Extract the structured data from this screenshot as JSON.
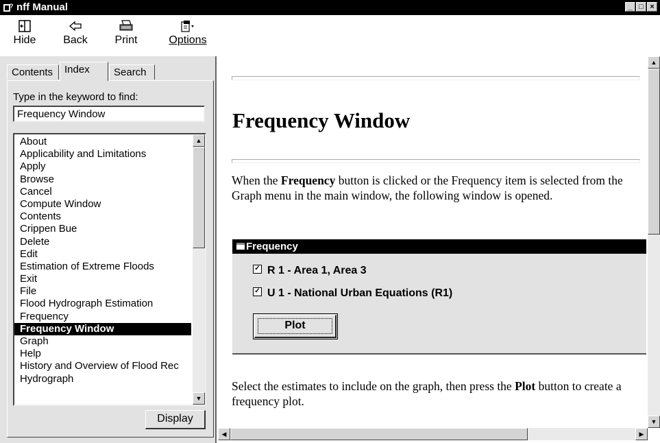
{
  "window": {
    "title": "nff Manual"
  },
  "toolbar": {
    "hide": "Hide",
    "back": "Back",
    "print": "Print",
    "options": "Options"
  },
  "tabs": {
    "contents": "Contents",
    "index": "Index",
    "search": "Search"
  },
  "index": {
    "label": "Type in the keyword to find:",
    "value": "Frequency Window",
    "items": [
      "About",
      "Applicability and Limitations",
      "Apply",
      "Browse",
      "Cancel",
      "Compute Window",
      "Contents",
      "Crippen Bue",
      "Delete",
      "Edit",
      "Estimation of Extreme Floods",
      "Exit",
      "File",
      "Flood Hydrograph Estimation",
      "Frequency",
      "Frequency Window",
      "Graph",
      "Help",
      "History and Overview of Flood Rec",
      "Hydrograph"
    ],
    "selected": "Frequency Window",
    "display_button": "Display"
  },
  "content": {
    "title": "Frequency Window",
    "para1_before": "When the ",
    "para1_bold": "Frequency",
    "para1_after": " button is clicked or the Frequency item is selected from the Graph menu in the main window, the following window is opened.",
    "dialog": {
      "title": "Frequency",
      "checks": [
        {
          "label": "R 1 - Area 1, Area 3",
          "checked": true
        },
        {
          "label": "U 1 - National Urban Equations (R1)",
          "checked": true
        }
      ],
      "plot_button": "Plot"
    },
    "para2_before": "Select the estimates to include on the graph, then press the ",
    "para2_bold": "Plot",
    "para2_after": " button to create a frequency plot."
  }
}
